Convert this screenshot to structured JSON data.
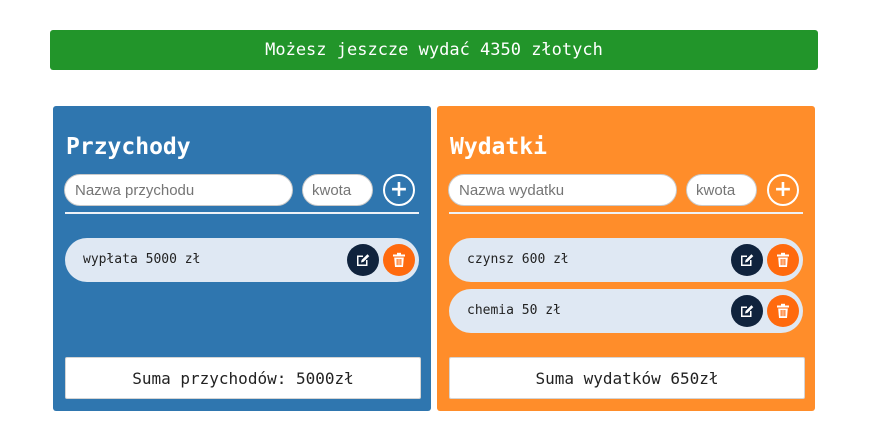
{
  "banner": {
    "text": "Możesz jeszcze wydać 4350 złotych"
  },
  "income": {
    "title": "Przychody",
    "name_placeholder": "Nazwa przychodu",
    "amount_placeholder": "kwota",
    "add_icon": "plus-icon",
    "items": [
      {
        "text": "wypłata 5000 zł"
      }
    ],
    "sum": "Suma przychodów: 5000zł"
  },
  "expense": {
    "title": "Wydatki",
    "name_placeholder": "Nazwa wydatku",
    "amount_placeholder": "kwota",
    "add_icon": "plus-icon",
    "items": [
      {
        "text": "czynsz 600 zł"
      },
      {
        "text": "chemia 50 zł"
      }
    ],
    "sum": "Suma wydatków 650zł"
  },
  "icons": {
    "edit": "edit-icon",
    "delete": "trash-icon"
  },
  "colors": {
    "banner": "#22952a",
    "income_panel": "#2f76af",
    "expense_panel": "#ff8d2a",
    "edit_button": "#10233d",
    "delete_button": "#ff6a0e"
  }
}
